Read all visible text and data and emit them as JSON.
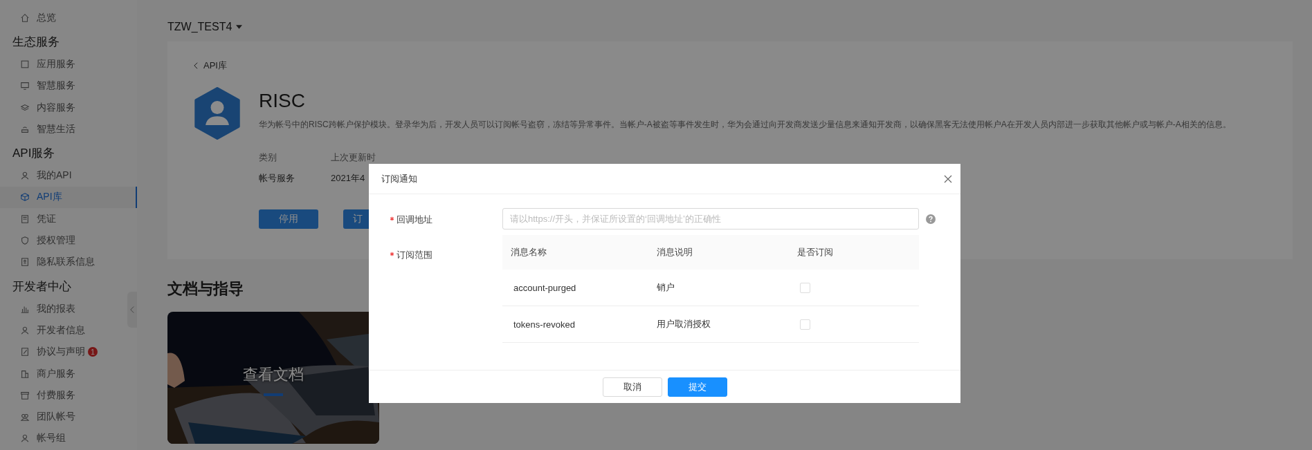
{
  "header": {
    "account": "TZW_TEST4"
  },
  "sidebar": {
    "items": [
      {
        "kind": "link",
        "label": "总览",
        "selected": false
      },
      {
        "kind": "heading",
        "label": "生态服务"
      },
      {
        "kind": "link",
        "label": "应用服务",
        "selected": false
      },
      {
        "kind": "link",
        "label": "智慧服务",
        "selected": false
      },
      {
        "kind": "link",
        "label": "内容服务",
        "selected": false
      },
      {
        "kind": "link",
        "label": "智慧生活",
        "selected": false
      },
      {
        "kind": "heading",
        "label": "API服务"
      },
      {
        "kind": "link",
        "label": "我的API",
        "selected": false
      },
      {
        "kind": "link",
        "label": "API库",
        "selected": true
      },
      {
        "kind": "link",
        "label": "凭证",
        "selected": false
      },
      {
        "kind": "link",
        "label": "授权管理",
        "selected": false
      },
      {
        "kind": "link",
        "label": "隐私联系信息",
        "selected": false
      },
      {
        "kind": "heading",
        "label": "开发者中心"
      },
      {
        "kind": "link",
        "label": "我的报表",
        "selected": false
      },
      {
        "kind": "link",
        "label": "开发者信息",
        "selected": false
      },
      {
        "kind": "link",
        "label": "协议与声明",
        "selected": false,
        "badge": "1"
      },
      {
        "kind": "link",
        "label": "商户服务",
        "selected": false
      },
      {
        "kind": "link",
        "label": "付费服务",
        "selected": false
      },
      {
        "kind": "link",
        "label": "团队帐号",
        "selected": false
      },
      {
        "kind": "link",
        "label": "帐号组",
        "selected": false
      }
    ]
  },
  "detail": {
    "back": "API库",
    "title": "RISC",
    "description": "华为帐号中的RISC跨帐户保护模块。登录华为后，开发人员可以订阅帐号盗窃，冻结等异常事件。当帐户-A被盗等事件发生时，华为会通过向开发商发送少量信息来通知开发商，以确保黑客无法使用帐户A在开发人员内部进一步获取其他帐户或与帐户-A相关的信息。",
    "meta": [
      {
        "label": "类别",
        "value": "帐号服务"
      },
      {
        "label": "上次更新时",
        "value": "2021年4"
      }
    ],
    "buttons": [
      "停用",
      "订"
    ]
  },
  "docs": {
    "title": "文档与指导",
    "card": {
      "kind": "picture",
      "label": "查看文档"
    }
  },
  "dialog": {
    "title": "订阅通知",
    "fields": [
      {
        "label": "回调地址",
        "required": true,
        "placeholder": "请以https://开头，并保证所设置的‘回调地址’的正确性"
      },
      {
        "label": "订阅范围",
        "required": true
      }
    ],
    "table": {
      "columns": [
        "消息名称",
        "消息说明",
        "是否订阅"
      ],
      "rows": [
        {
          "name": "account-purged",
          "description": "销户",
          "checked": false
        },
        {
          "name": "tokens-revoked",
          "description": "用户取消授权",
          "checked": false
        }
      ]
    },
    "buttons": [
      {
        "label": "取消",
        "kind": "secondary"
      },
      {
        "label": "提交",
        "kind": "primary"
      }
    ]
  }
}
